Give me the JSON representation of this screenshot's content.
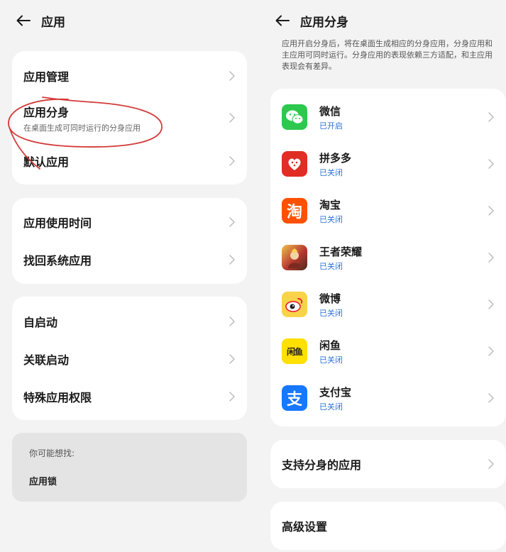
{
  "left": {
    "header": {
      "title": "应用"
    },
    "group1": [
      {
        "label": "应用管理",
        "sub": ""
      },
      {
        "label": "应用分身",
        "sub": "在桌面生成可同时运行的分身应用"
      },
      {
        "label": "默认应用",
        "sub": ""
      }
    ],
    "group2": [
      {
        "label": "应用使用时间"
      },
      {
        "label": "找回系统应用"
      }
    ],
    "group3": [
      {
        "label": "自启动"
      },
      {
        "label": "关联启动"
      },
      {
        "label": "特殊应用权限"
      }
    ],
    "suggest": {
      "hint": "你可能想找:",
      "item": "应用锁"
    },
    "annotation_color": "#d33a3a"
  },
  "right": {
    "header": {
      "title": "应用分身"
    },
    "description": "应用开启分身后，将在桌面生成相应的分身应用，分身应用和主应用可同时运行。分身应用的表现依赖三方适配，和主应用表现会有差异。",
    "apps": [
      {
        "name": "微信",
        "status": "已开启",
        "icon": "wechat-icon",
        "color": "#2dc84d"
      },
      {
        "name": "拼多多",
        "status": "已关闭",
        "icon": "pinduoduo-icon",
        "color": "#e02e24"
      },
      {
        "name": "淘宝",
        "status": "已关闭",
        "icon": "taobao-icon",
        "color": "#ff5000"
      },
      {
        "name": "王者荣耀",
        "status": "已关闭",
        "icon": "honor-of-kings-icon",
        "color": "#b5372f"
      },
      {
        "name": "微博",
        "status": "已关闭",
        "icon": "weibo-icon",
        "color": "#f5c342"
      },
      {
        "name": "闲鱼",
        "status": "已关闭",
        "icon": "xianyu-icon",
        "color": "#ffe000"
      },
      {
        "name": "支付宝",
        "status": "已关闭",
        "icon": "alipay-icon",
        "color": "#1677ff"
      }
    ],
    "supported_label": "支持分身的应用",
    "advanced_label": "高级设置",
    "status_color": "#2b6fd6"
  }
}
